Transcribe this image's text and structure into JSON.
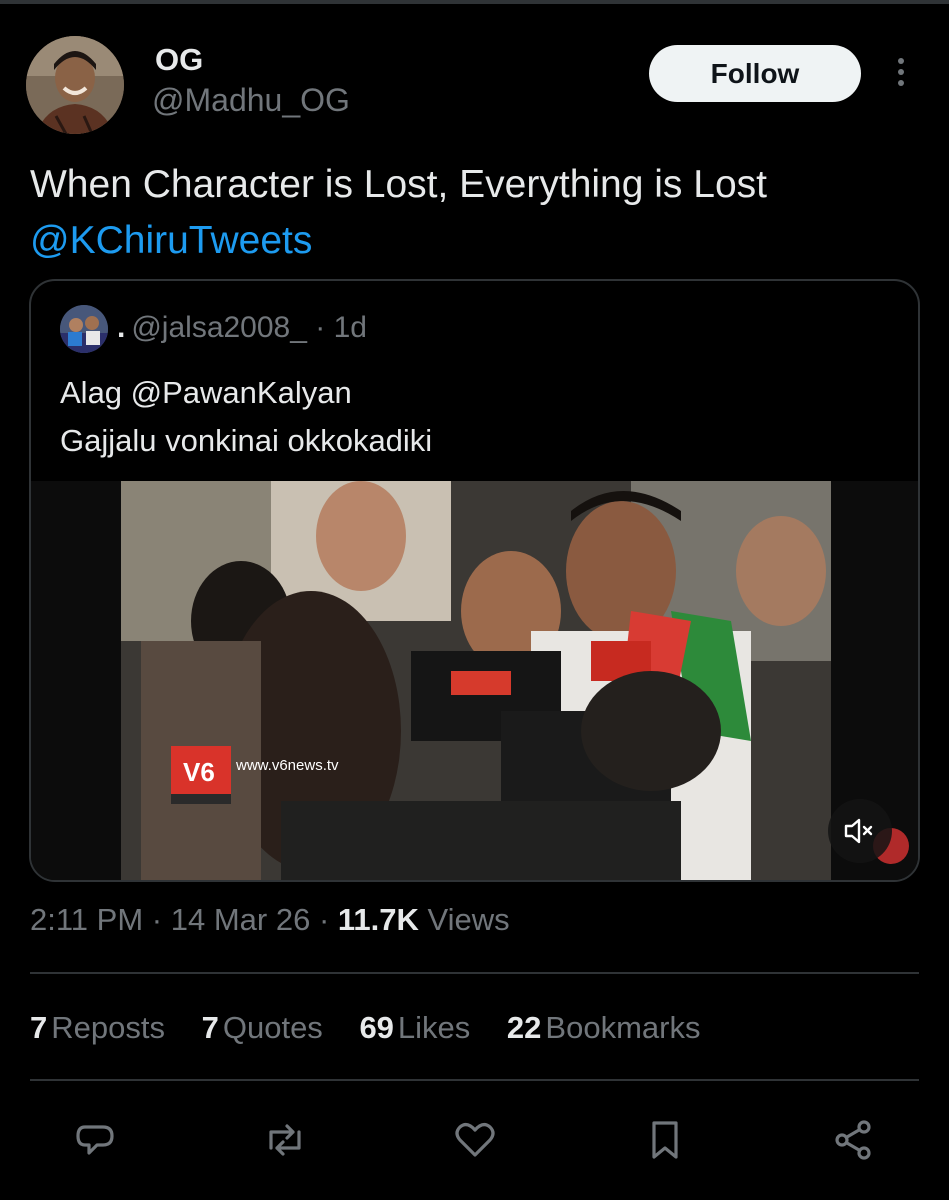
{
  "author": {
    "display_name": "OG",
    "handle": "@Madhu_OG"
  },
  "follow_label": "Follow",
  "tweet": {
    "text": "When Character is Lost, Everything is Lost",
    "mention": "@KChiruTweets"
  },
  "quote": {
    "name": ".",
    "handle": "@jalsa2008_",
    "time": "· 1d",
    "line1": "Alag @PawanKalyan",
    "line2": "Gajjalu vonkinai okkokadiki",
    "watermark": "www.v6news.tv"
  },
  "meta": {
    "time": "2:11 PM",
    "sep1": "·",
    "date": "14 Mar 26",
    "sep2": "·",
    "views_count": "11.7K",
    "views_label": "Views"
  },
  "stats": [
    {
      "count": "7",
      "label": "Reposts"
    },
    {
      "count": "7",
      "label": "Quotes"
    },
    {
      "count": "69",
      "label": "Likes"
    },
    {
      "count": "22",
      "label": "Bookmarks"
    }
  ],
  "actions": [
    "reply-icon",
    "repost-icon",
    "like-icon",
    "bookmark-icon",
    "share-icon"
  ],
  "colors": {
    "background": "#000000",
    "text": "#e7e9ea",
    "muted": "#71767b",
    "link": "#1d9bf0",
    "border": "#2f3336"
  }
}
